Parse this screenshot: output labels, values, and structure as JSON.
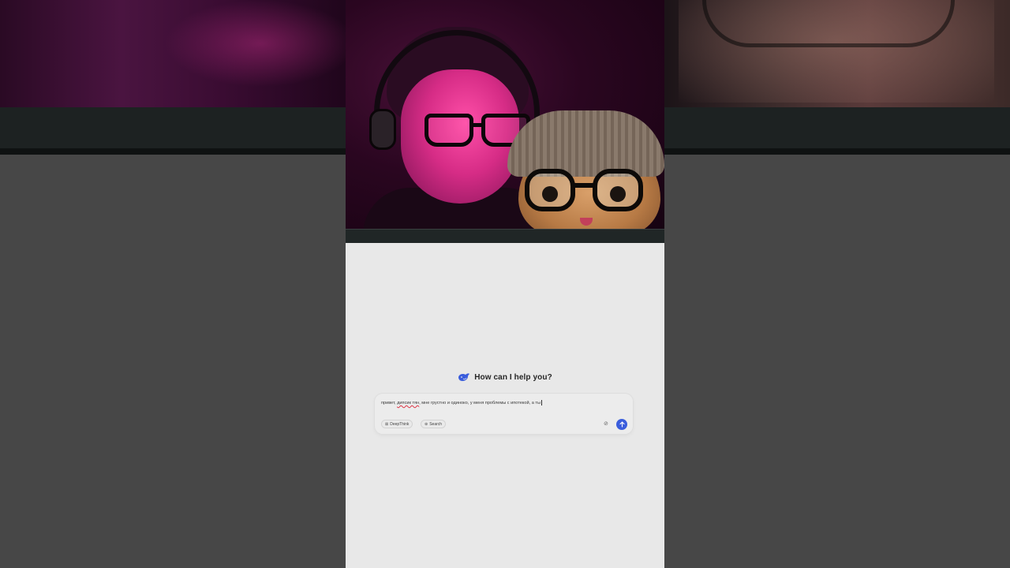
{
  "chat": {
    "greeting": "How can I help you?",
    "input_value": {
      "part1": "привет, ",
      "misspelled": "дипсик тян",
      "part2": ", мне грустно и одиноко, у меня проблемы с ипотекой, а ты"
    },
    "buttons": {
      "deepthink_label": "DeepThink",
      "search_label": "Search"
    },
    "icons": {
      "logo": "deepseek-whale-icon",
      "deepthink": "atom-icon",
      "search": "globe-icon",
      "attach": "paperclip-icon",
      "send": "arrow-up-icon"
    }
  },
  "colors": {
    "accent": "#3a5ddc",
    "chat_background": "#e8e8e8",
    "page_background": "#474747",
    "webcam_tint": "#d62c86"
  }
}
